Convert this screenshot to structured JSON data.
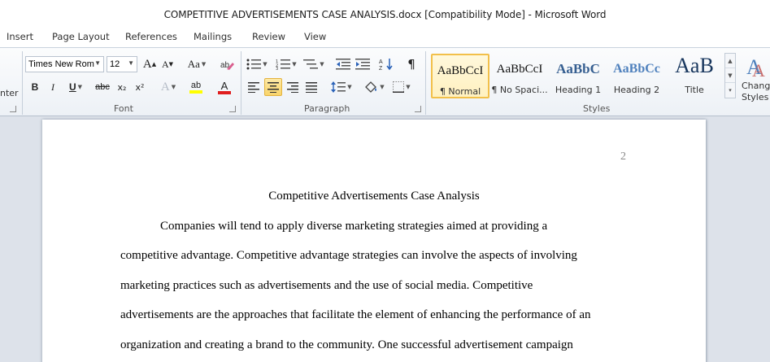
{
  "window": {
    "title": "COMPETITIVE ADVERTISEMENTS CASE ANALYSIS.docx [Compatibility Mode]  -  Microsoft Word"
  },
  "tabs": [
    "Insert",
    "Page Layout",
    "References",
    "Mailings",
    "Review",
    "View"
  ],
  "ribbon": {
    "clipboard_partial_label": "nter",
    "font": {
      "label": "Font",
      "font_name": "Times New Rom",
      "font_size": "12",
      "grow": "A",
      "shrink": "A",
      "change_case": "Aa",
      "bold": "B",
      "italic": "I",
      "underline": "U",
      "strikethrough": "abc",
      "subscript": "x₂",
      "superscript": "x²",
      "text_effects": "A",
      "highlight": "ab",
      "font_color": "A"
    },
    "paragraph": {
      "label": "Paragraph",
      "show_marks": "¶"
    },
    "styles": {
      "label": "Styles",
      "items": [
        {
          "sample": "AaBbCcI",
          "name": "¶ Normal"
        },
        {
          "sample": "AaBbCcI",
          "name": "¶ No Spaci..."
        },
        {
          "sample": "AaBbC",
          "name": "Heading 1"
        },
        {
          "sample": "AaBbCc",
          "name": "Heading 2"
        },
        {
          "sample": "AaB",
          "name": "Title"
        }
      ],
      "change_styles_line1": "Chang",
      "change_styles_line2": "Styles"
    }
  },
  "colors": {
    "heading": "#365f91",
    "heading2": "#4f81bd",
    "highlight": "#ffff00",
    "font_color": "#e01e1e",
    "selected_style": "#f2c04a"
  },
  "document": {
    "page_number": "2",
    "title": "Competitive Advertisements Case Analysis",
    "lines": [
      "Companies will tend to apply diverse marketing strategies aimed at providing a",
      "competitive advantage. Competitive advantage strategies can involve the aspects of involving",
      "marketing practices such as advertisements and the use of social media. Competitive",
      "advertisements are the approaches that facilitate the element of enhancing the performance of an",
      "organization and creating a brand to the community. One successful advertisement campaign"
    ]
  }
}
